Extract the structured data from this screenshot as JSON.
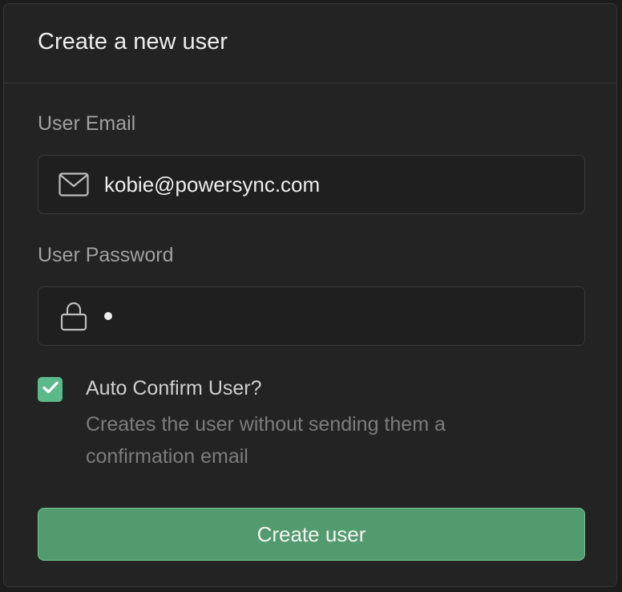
{
  "dialog": {
    "title": "Create a new user"
  },
  "email_field": {
    "label": "User Email",
    "value": "kobie@powersync.com",
    "icon": "mail-icon"
  },
  "password_field": {
    "label": "User Password",
    "value_masked": "•",
    "icon": "lock-icon"
  },
  "auto_confirm": {
    "checked": true,
    "label": "Auto Confirm User?",
    "description": "Creates the user without sending them a confirmation email"
  },
  "submit": {
    "label": "Create user"
  },
  "colors": {
    "accent": "#529b6e",
    "accent_border": "#75c593",
    "checkbox": "#5cb98a",
    "background": "#232323"
  }
}
